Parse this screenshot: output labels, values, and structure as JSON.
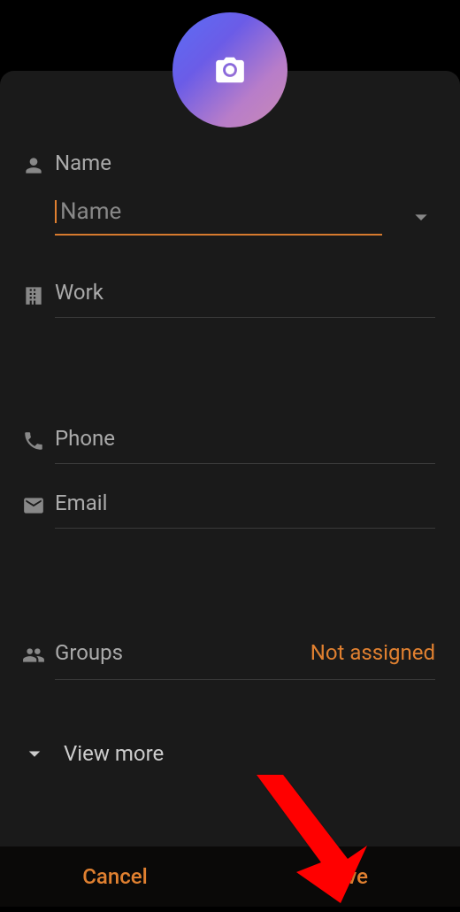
{
  "name": {
    "label": "Name",
    "placeholder": "Name"
  },
  "work": {
    "label": "Work"
  },
  "phone": {
    "label": "Phone"
  },
  "email": {
    "label": "Email"
  },
  "groups": {
    "label": "Groups",
    "value": "Not assigned"
  },
  "viewMore": {
    "label": "View more"
  },
  "buttons": {
    "cancel": "Cancel",
    "save": "Save"
  }
}
